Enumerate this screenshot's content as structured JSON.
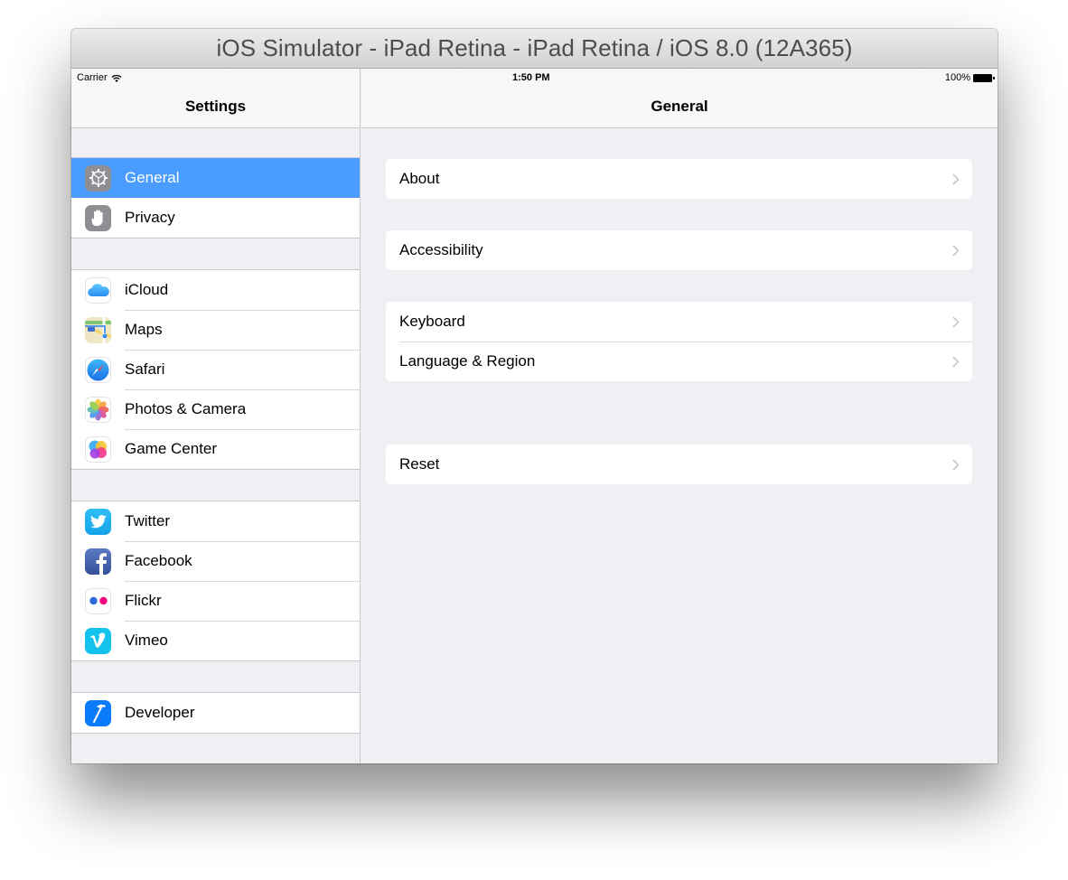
{
  "window": {
    "title": "iOS Simulator - iPad Retina - iPad Retina / iOS 8.0 (12A365)"
  },
  "status_bar": {
    "carrier": "Carrier",
    "time": "1:50 PM",
    "battery": "100%"
  },
  "master": {
    "title": "Settings",
    "groups": [
      {
        "items": [
          {
            "label": "General",
            "icon": "gear-icon",
            "selected": true
          },
          {
            "label": "Privacy",
            "icon": "hand-icon"
          }
        ]
      },
      {
        "items": [
          {
            "label": "iCloud",
            "icon": "icloud-icon"
          },
          {
            "label": "Maps",
            "icon": "maps-icon"
          },
          {
            "label": "Safari",
            "icon": "safari-compass-icon"
          },
          {
            "label": "Photos & Camera",
            "icon": "photos-flower-icon"
          },
          {
            "label": "Game Center",
            "icon": "game-center-icon"
          }
        ]
      },
      {
        "items": [
          {
            "label": "Twitter",
            "icon": "twitter-bird-icon"
          },
          {
            "label": "Facebook",
            "icon": "facebook-f-icon"
          },
          {
            "label": "Flickr",
            "icon": "flickr-dots-icon"
          },
          {
            "label": "Vimeo",
            "icon": "vimeo-v-icon"
          }
        ]
      },
      {
        "items": [
          {
            "label": "Developer",
            "icon": "hammer-icon"
          }
        ]
      }
    ]
  },
  "detail": {
    "title": "General",
    "groups": [
      {
        "items": [
          {
            "label": "About"
          }
        ]
      },
      {
        "items": [
          {
            "label": "Accessibility"
          }
        ]
      },
      {
        "items": [
          {
            "label": "Keyboard"
          },
          {
            "label": "Language & Region"
          }
        ]
      },
      {
        "items": [
          {
            "label": "Reset"
          }
        ]
      }
    ]
  },
  "colors": {
    "selection": "#4a9cff",
    "background": "#efeff4",
    "separator": "#c8c7cc",
    "chevron": "#c7c7cc"
  }
}
